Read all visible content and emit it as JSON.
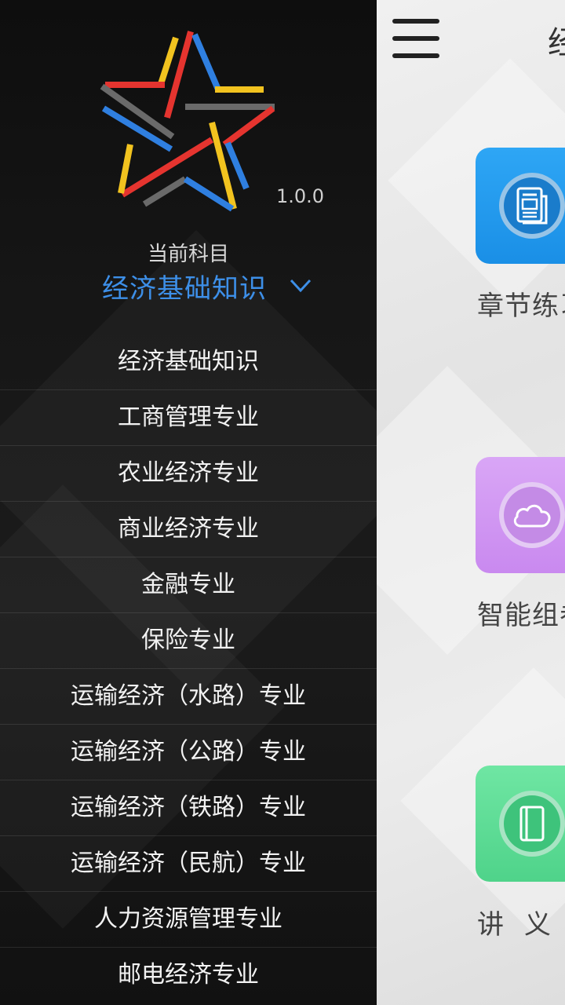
{
  "app": {
    "title": "经济基础知识",
    "version": "1.0.0"
  },
  "drawer": {
    "current_subject_caption": "当前科目",
    "current_subject": "经济基础知识",
    "subjects": [
      "经济基础知识",
      "工商管理专业",
      "农业经济专业",
      "商业经济专业",
      "金融专业",
      "保险专业",
      "运输经济（水路）专业",
      "运输经济（公路）专业",
      "运输经济（铁路）专业",
      "运输经济（民航）专业",
      "人力资源管理专业",
      "邮电经济专业"
    ]
  },
  "main": {
    "features": [
      {
        "label": "章节练习",
        "icon": "document-icon"
      },
      {
        "label": "智能组卷",
        "icon": "cloud-icon"
      },
      {
        "label": "讲义",
        "icon": "book-icon"
      }
    ]
  },
  "colors": {
    "accent": "#3d8fe8",
    "chapter_tile": "#1a8fe6",
    "smart_tile": "#c989ef",
    "lecture_tile": "#4fd38a"
  }
}
